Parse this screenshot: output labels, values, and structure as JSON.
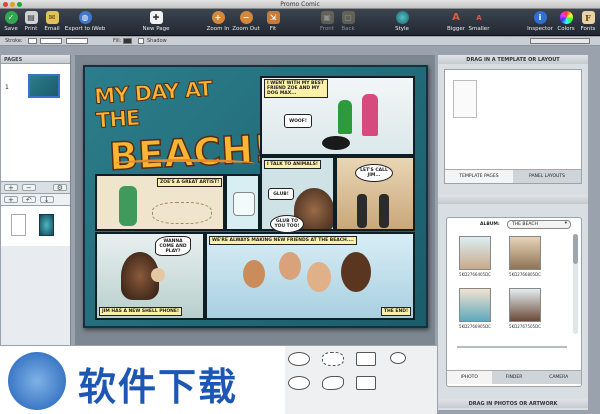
{
  "window": {
    "title": "Promo Comic"
  },
  "toolbar": {
    "save": "Save",
    "print": "Print",
    "email": "Email",
    "export": "Export to iWeb",
    "new_page": "New Page",
    "zoom_in": "Zoom In",
    "zoom_out": "Zoom Out",
    "fit": "Fit",
    "front": "Front",
    "back": "Back",
    "style": "Style",
    "bigger": "Bigger",
    "smaller": "Smaller",
    "inspector": "Inspector",
    "colors": "Colors",
    "fonts": "Fonts"
  },
  "format_bar": {
    "stroke": "Stroke:",
    "fill": "Fill:",
    "shadow": "Shadow"
  },
  "pages_panel": {
    "header": "PAGES",
    "page_number": "1"
  },
  "comic": {
    "title_line1": "MY DAY AT THE",
    "title_line2": "BEACH!",
    "cap_friend": "I WENT WITH MY BEST FRIEND ZOE AND MY DOG MAX...",
    "bubble_woof": "WOOF!",
    "cap_animals": "I TALK TO ANIMALS!",
    "bubble_letscall": "LET'S CALL JIM...",
    "cap_artist": "ZOE'S A GREAT ARTIST!",
    "bubble_glub": "GLUB!",
    "bubble_glub_too": "GLUB TO YOU TOO!",
    "bubble_wanna": "WANNA COME AND PLAY?",
    "cap_friends": "WE'RE ALWAYS MAKING NEW FRIENDS AT THE BEACH....",
    "cap_shell": "JIM HAS A NEW SHELL PHONE!",
    "cap_end": "THE END!"
  },
  "templates": {
    "header": "DRAG IN A TEMPLATE OR LAYOUT",
    "tab_pages": "TEMPLATE PAGES",
    "tab_layouts": "PANEL LAYOUTS"
  },
  "media": {
    "album_label": "ALBUM:",
    "album_value": "THE BEACH",
    "photos": [
      "5KD2766405DC",
      "5KD2766805DC",
      "5KD2766905DC",
      "5KD2767505DC"
    ],
    "tab_iphoto": "IPHOTO",
    "tab_finder": "FINDER",
    "tab_camera": "CAMERA",
    "footer": "DRAG IN PHOTOS OR ARTWORK"
  },
  "watermark": {
    "text": "软件下载"
  }
}
